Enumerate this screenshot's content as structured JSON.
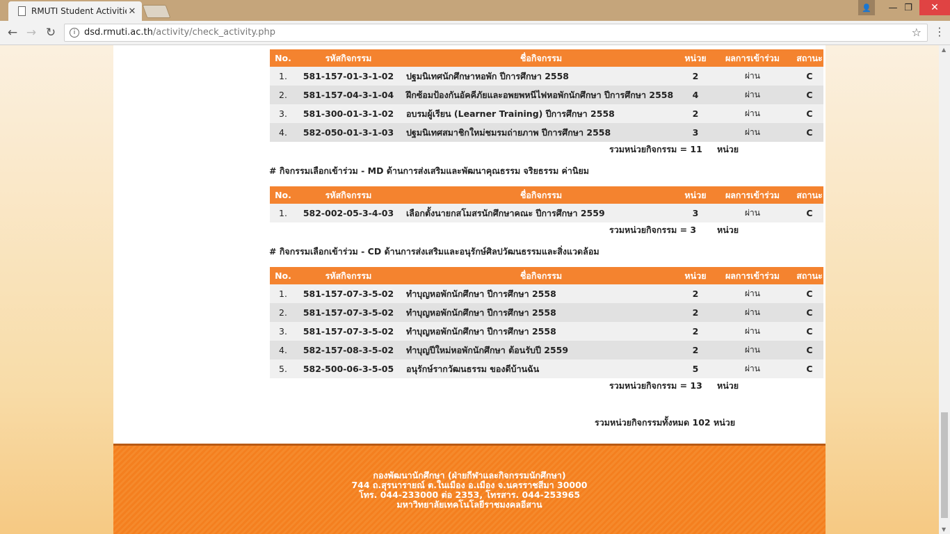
{
  "browser": {
    "tab_title": "RMUTI Student Activities",
    "tab_close": "✕",
    "url_domain": "dsd.rmuti.ac.th",
    "url_path": "/activity/check_activity.php",
    "window_user": "👤",
    "window_minimize": "—",
    "window_maximize": "❐",
    "window_close": "✕",
    "nav_back": "←",
    "nav_forward": "→",
    "nav_reload": "↻",
    "info": "i",
    "star": "☆",
    "menu": "⋮"
  },
  "table_headers": {
    "no": "No.",
    "code": "รหัสกิจกรรม",
    "name": "ชื่อกิจกรรม",
    "unit": "หน่วย",
    "result": "ผลการเข้าร่วม",
    "status": "สถานะ"
  },
  "sections": [
    {
      "title": "",
      "rows": [
        {
          "no": "1.",
          "code": "581-157-01-3-1-02",
          "name": "ปฐมนิเทศนักศึกษาหอพัก ปีการศึกษา 2558",
          "unit": "2",
          "result": "ผ่าน",
          "status": "C"
        },
        {
          "no": "2.",
          "code": "581-157-04-3-1-04",
          "name": "ฝึกซ้อมป้องกันอัคคีภัยและอพยพหนีไฟหอพักนักศึกษา ปีการศึกษา 2558",
          "unit": "4",
          "result": "ผ่าน",
          "status": "C"
        },
        {
          "no": "3.",
          "code": "581-300-01-3-1-02",
          "name": "อบรมผู้เรียน (Learner Training) ปีการศึกษา 2558",
          "unit": "2",
          "result": "ผ่าน",
          "status": "C"
        },
        {
          "no": "4.",
          "code": "582-050-01-3-1-03",
          "name": "ปฐมนิเทศสมาชิกใหม่ชมรมถ่ายภาพ ปีการศึกษา 2558",
          "unit": "3",
          "result": "ผ่าน",
          "status": "C"
        }
      ],
      "total_label": "รวมหน่วยกิจกรรม = 11",
      "total_unit": "หน่วย"
    },
    {
      "title": "# กิจกรรมเลือกเข้าร่วม - MD ด้านการส่งเสริมและพัฒนาคุณธรรม จริยธรรม ค่านิยม",
      "rows": [
        {
          "no": "1.",
          "code": "582-002-05-3-4-03",
          "name": "เลือกตั้งนายกสโมสรนักศึกษาคณะ ปีการศึกษา 2559",
          "unit": "3",
          "result": "ผ่าน",
          "status": "C"
        }
      ],
      "total_label": "รวมหน่วยกิจกรรม = 3",
      "total_unit": "หน่วย"
    },
    {
      "title": "# กิจกรรมเลือกเข้าร่วม - CD ด้านการส่งเสริมและอนุรักษ์ศิลปวัฒนธรรมและสิ่งแวดล้อม",
      "rows": [
        {
          "no": "1.",
          "code": "581-157-07-3-5-02",
          "name": "ทำบุญหอพักนักศึกษา ปีการศึกษา 2558",
          "unit": "2",
          "result": "ผ่าน",
          "status": "C"
        },
        {
          "no": "2.",
          "code": "581-157-07-3-5-02",
          "name": "ทำบุญหอพักนักศึกษา ปีการศึกษา 2558",
          "unit": "2",
          "result": "ผ่าน",
          "status": "C"
        },
        {
          "no": "3.",
          "code": "581-157-07-3-5-02",
          "name": "ทำบุญหอพักนักศึกษา ปีการศึกษา 2558",
          "unit": "2",
          "result": "ผ่าน",
          "status": "C"
        },
        {
          "no": "4.",
          "code": "582-157-08-3-5-02",
          "name": "ทำบุญปีใหม่หอพักนักศึกษา ต้อนรับปี 2559",
          "unit": "2",
          "result": "ผ่าน",
          "status": "C"
        },
        {
          "no": "5.",
          "code": "582-500-06-3-5-05",
          "name": "อนุรักษ์รากวัฒนธรรม ของดีบ้านฉัน",
          "unit": "5",
          "result": "ผ่าน",
          "status": "C"
        }
      ],
      "total_label": "รวมหน่วยกิจกรรม = 13",
      "total_unit": "หน่วย"
    }
  ],
  "grand_total": "รวมหน่วยกิจกรรมทั้งหมด 102 หน่วย",
  "footer": {
    "line1": "กองพัฒนานักศึกษา (ฝ่ายกีฬาและกิจกรรมนักศึกษา)",
    "line2": "744 ถ.สุรนารายณ์ ต.ในเมือง อ.เมือง จ.นครราชสีมา 30000",
    "line3": "โทร. 044-233000 ต่อ 2353, โทรสาร. 044-253965",
    "line4": "มหาวิทยาลัยเทคโนโลยีราชมงคลอีสาน"
  },
  "colors": {
    "header_orange": "#f4832f",
    "code_navy": "#1a1a66",
    "pass_green": "#2e7d32"
  }
}
